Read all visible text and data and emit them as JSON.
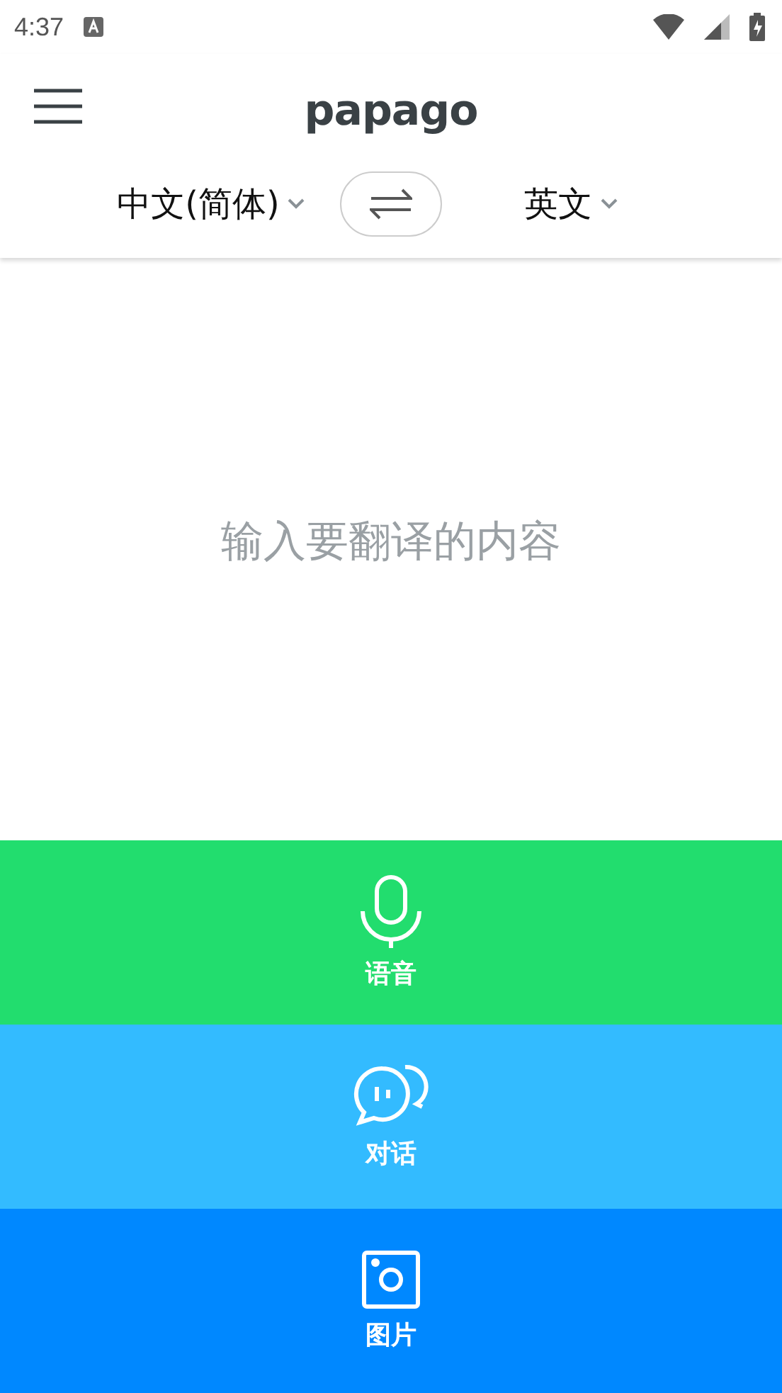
{
  "status_bar": {
    "time": "4:37"
  },
  "header": {
    "logo": "papago"
  },
  "languages": {
    "source": "中文(简体)",
    "target": "英文"
  },
  "input": {
    "placeholder": "输入要翻译的内容"
  },
  "modes": [
    {
      "kind": "voice",
      "label": "语音",
      "color": "#22dd6e"
    },
    {
      "kind": "conversation",
      "label": "对话",
      "color": "#33bbff"
    },
    {
      "kind": "image",
      "label": "图片",
      "color": "#0088ff"
    }
  ]
}
